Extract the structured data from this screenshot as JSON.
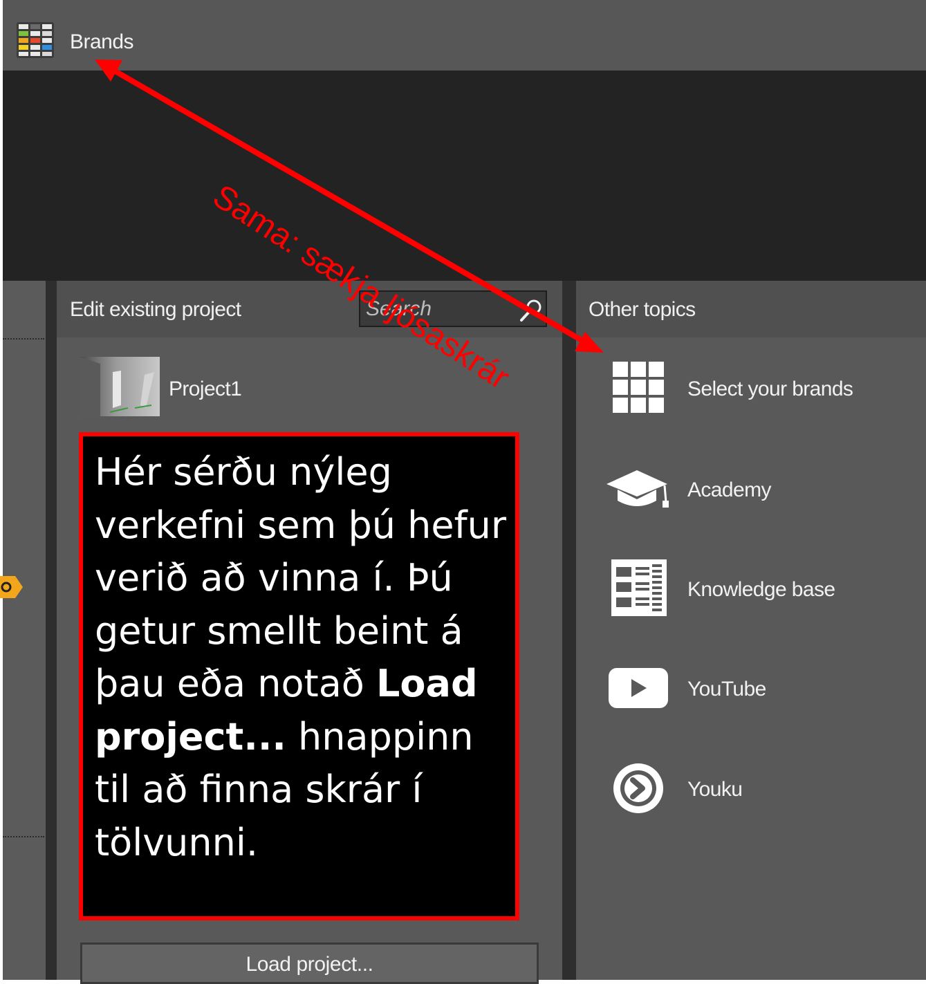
{
  "topbar": {
    "title": "Brands"
  },
  "edit_panel": {
    "title": "Edit existing project",
    "search_placeholder": "Search",
    "project": {
      "name": "Project1"
    },
    "load_button": "Load project..."
  },
  "other_topics": {
    "title": "Other topics",
    "items": [
      {
        "label": "Select your brands",
        "icon": "grid-icon"
      },
      {
        "label": "Academy",
        "icon": "graduation-cap-icon"
      },
      {
        "label": "Knowledge base",
        "icon": "knowledge-base-icon"
      },
      {
        "label": "YouTube",
        "icon": "youtube-icon"
      },
      {
        "label": "Youku",
        "icon": "youku-icon"
      }
    ]
  },
  "annotation": {
    "arrow_label": "Sama: sækja ljósaskrár",
    "callout": {
      "part1": "Hér sérðu nýleg verkefni sem þú hefur verið að vinna í. Þú getur smellt beint á þau eða notað ",
      "bold": "Load project...",
      "part2": " hnappinn til að finna skrár í tölvunni."
    },
    "color": "#ff0000"
  }
}
